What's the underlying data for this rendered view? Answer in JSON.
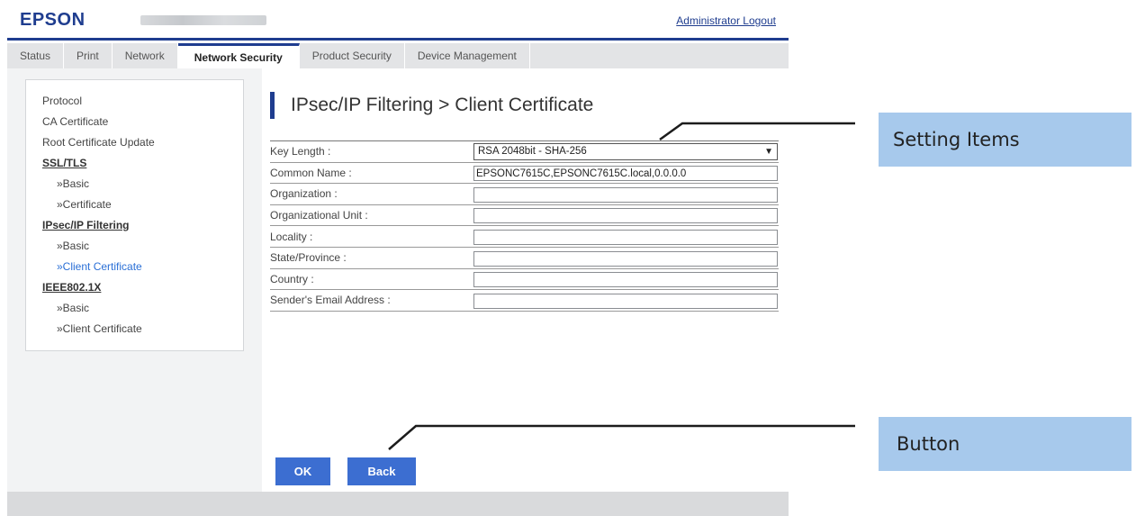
{
  "header": {
    "logo": "EPSON",
    "logout": "Administrator Logout"
  },
  "tabs": [
    {
      "label": "Status"
    },
    {
      "label": "Print"
    },
    {
      "label": "Network"
    },
    {
      "label": "Network Security",
      "active": true
    },
    {
      "label": "Product Security"
    },
    {
      "label": "Device Management"
    }
  ],
  "sidebar": {
    "items": [
      {
        "label": "Protocol"
      },
      {
        "label": "CA Certificate"
      },
      {
        "label": "Root Certificate Update"
      },
      {
        "label": "SSL/TLS"
      },
      {
        "label": "»Basic"
      },
      {
        "label": "»Certificate"
      },
      {
        "label": "IPsec/IP Filtering"
      },
      {
        "label": "»Basic"
      },
      {
        "label": "»Client Certificate"
      },
      {
        "label": "IEEE802.1X"
      },
      {
        "label": "»Basic"
      },
      {
        "label": "»Client Certificate"
      }
    ]
  },
  "main": {
    "title": "IPsec/IP Filtering > Client Certificate",
    "form": {
      "key_length": {
        "label": "Key Length :",
        "value": "RSA 2048bit - SHA-256"
      },
      "common_name": {
        "label": "Common Name :",
        "value": "EPSONC7615C,EPSONC7615C.local,0.0.0.0"
      },
      "organization": {
        "label": "Organization :",
        "value": ""
      },
      "organizational_unit": {
        "label": "Organizational Unit :",
        "value": ""
      },
      "locality": {
        "label": "Locality :",
        "value": ""
      },
      "state_province": {
        "label": "State/Province :",
        "value": ""
      },
      "country": {
        "label": "Country :",
        "value": ""
      },
      "sender_email": {
        "label": "Sender's Email Address :",
        "value": ""
      }
    },
    "buttons": {
      "ok": "OK",
      "back": "Back"
    }
  },
  "callouts": {
    "settings": "Setting Items",
    "button": "Button"
  },
  "colors": {
    "brand": "#1f3d8f",
    "button": "#3c6ed1",
    "callout": "#a7c9ec",
    "link_current": "#2a6fd6"
  }
}
